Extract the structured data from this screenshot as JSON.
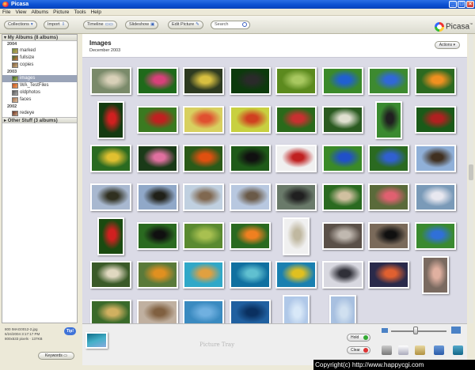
{
  "window": {
    "title": "Picasa"
  },
  "menu": [
    "File",
    "View",
    "Albums",
    "Picture",
    "Tools",
    "Help"
  ],
  "toolbar": {
    "collections": "Collections",
    "import": "Import",
    "timeline": "Timeline",
    "slideshow": "Slideshow",
    "edit_picture": "Edit Picture",
    "search_placeholder": "Search"
  },
  "brand": {
    "name": "Picasa"
  },
  "sidebar": {
    "header": "My Albums (8 albums)",
    "groups": [
      {
        "year": "2004",
        "items": [
          "marked",
          "fullsize",
          "copies"
        ]
      },
      {
        "year": "2003",
        "items": [
          "images",
          "WA_TestFiles",
          "oldphotos",
          "faces"
        ]
      },
      {
        "year": "2002",
        "items": [
          "redeye"
        ]
      }
    ],
    "selected": "images",
    "other": "Other Stuff (3 albums)"
  },
  "fileinfo": {
    "line1": "800 IMAG0012-2.jpg",
    "line2": "6/24/2004 3:17:17 PM",
    "line3": "800x533 pixels · 137KB"
  },
  "tip_label": "Tip!",
  "keywords_label": "Keywords",
  "album": {
    "title": "Images",
    "date": "December 2003",
    "actions": "Actions"
  },
  "tray": {
    "label": "Picture Tray",
    "hold": "Hold",
    "clear": "Clear"
  },
  "thumbs": [
    {
      "c": [
        "#7a8a6a",
        "#d8d0b8"
      ],
      "o": "l"
    },
    {
      "c": [
        "#1f6a1a",
        "#d7407a"
      ],
      "o": "l"
    },
    {
      "c": [
        "#2d3a20",
        "#d8c040"
      ],
      "o": "l"
    },
    {
      "c": [
        "#0c3a0c",
        "#2a2a2a"
      ],
      "o": "l"
    },
    {
      "c": [
        "#5c8a1e",
        "#a8c860"
      ],
      "o": "l"
    },
    {
      "c": [
        "#3b8a2a",
        "#2060d0"
      ],
      "o": "l"
    },
    {
      "c": [
        "#3d8a30",
        "#3068d8"
      ],
      "o": "l"
    },
    {
      "c": [
        "#2c6a20",
        "#f09020"
      ],
      "o": "l"
    },
    {
      "c": [
        "#143a10",
        "#d02020"
      ],
      "o": "p"
    },
    {
      "c": [
        "#3a7a20",
        "#c02020"
      ],
      "o": "l"
    },
    {
      "c": [
        "#d8d060",
        "#e05030"
      ],
      "o": "l"
    },
    {
      "c": [
        "#c8d040",
        "#d04020"
      ],
      "o": "l"
    },
    {
      "c": [
        "#2a6a1a",
        "#c83030"
      ],
      "o": "l"
    },
    {
      "c": [
        "#2a5a20",
        "#e0e0d0"
      ],
      "o": "l"
    },
    {
      "c": [
        "#3a8a30",
        "#202020"
      ],
      "o": "p"
    },
    {
      "c": [
        "#1a5a18",
        "#b02020"
      ],
      "o": "l"
    },
    {
      "c": [
        "#2a6a20",
        "#e0c030"
      ],
      "o": "l"
    },
    {
      "c": [
        "#1a3a18",
        "#e070a0"
      ],
      "o": "l"
    },
    {
      "c": [
        "#2a5a18",
        "#e05010"
      ],
      "o": "l"
    },
    {
      "c": [
        "#1e5a18",
        "#101010"
      ],
      "o": "l"
    },
    {
      "c": [
        "#f0f0f0",
        "#c02020"
      ],
      "o": "l"
    },
    {
      "c": [
        "#3a8a28",
        "#2050c8"
      ],
      "o": "l"
    },
    {
      "c": [
        "#2a6a20",
        "#3060d0"
      ],
      "o": "l"
    },
    {
      "c": [
        "#90b0d8",
        "#403020"
      ],
      "o": "l"
    },
    {
      "c": [
        "#a8b8d0",
        "#303020"
      ],
      "o": "l"
    },
    {
      "c": [
        "#90a8c8",
        "#202018"
      ],
      "o": "l"
    },
    {
      "c": [
        "#c0d0e0",
        "#806850"
      ],
      "o": "l"
    },
    {
      "c": [
        "#b8c8e0",
        "#6a5a48"
      ],
      "o": "l"
    },
    {
      "c": [
        "#6a7a6a",
        "#202020"
      ],
      "o": "l"
    },
    {
      "c": [
        "#2a6a20",
        "#d0c0a0"
      ],
      "o": "l"
    },
    {
      "c": [
        "#5a6a3a",
        "#e06070"
      ],
      "o": "l"
    },
    {
      "c": [
        "#7a9ab8",
        "#e8e8f0"
      ],
      "o": "l"
    },
    {
      "c": [
        "#1a4a10",
        "#d02020"
      ],
      "o": "p"
    },
    {
      "c": [
        "#2a6a20",
        "#101010"
      ],
      "o": "l"
    },
    {
      "c": [
        "#5a8a30",
        "#a8c050"
      ],
      "o": "l"
    },
    {
      "c": [
        "#2a6a20",
        "#f08020"
      ],
      "o": "l"
    },
    {
      "c": [
        "#f0f0f0",
        "#c0b8a0"
      ],
      "o": "p"
    },
    {
      "c": [
        "#5a5048",
        "#c0b8b0"
      ],
      "o": "l"
    },
    {
      "c": [
        "#7a6a5a",
        "#101010"
      ],
      "o": "l"
    },
    {
      "c": [
        "#3a8a30",
        "#3070d8"
      ],
      "o": "l"
    },
    {
      "c": [
        "#3a5a28",
        "#e0d8c0"
      ],
      "o": "l"
    },
    {
      "c": [
        "#5a7a3a",
        "#e09020"
      ],
      "o": "l"
    },
    {
      "c": [
        "#30a8c8",
        "#e0a040"
      ],
      "o": "l"
    },
    {
      "c": [
        "#1070a0",
        "#60c0d0"
      ],
      "o": "l"
    },
    {
      "c": [
        "#1a80b0",
        "#e0c020"
      ],
      "o": "l"
    },
    {
      "c": [
        "#d8d8e0",
        "#303038"
      ],
      "o": "l"
    },
    {
      "c": [
        "#2a2a4a",
        "#e06030"
      ],
      "o": "l"
    },
    {
      "c": [
        "#7a6a60",
        "#e0b0a0"
      ],
      "o": "p"
    },
    {
      "c": [
        "#3a6a2a",
        "#d0b060"
      ],
      "o": "l"
    },
    {
      "c": [
        "#c0b0a0",
        "#806040"
      ],
      "o": "l"
    },
    {
      "c": [
        "#3a8ac0",
        "#70b0e0"
      ],
      "o": "l"
    },
    {
      "c": [
        "#2060a0",
        "#0a3060"
      ],
      "o": "l"
    },
    {
      "c": [
        "#b0c8e8",
        "#d8e8f8"
      ],
      "o": "p"
    },
    {
      "c": [
        "#a8c0e0",
        "#d0e0f0"
      ],
      "o": "p"
    }
  ]
}
